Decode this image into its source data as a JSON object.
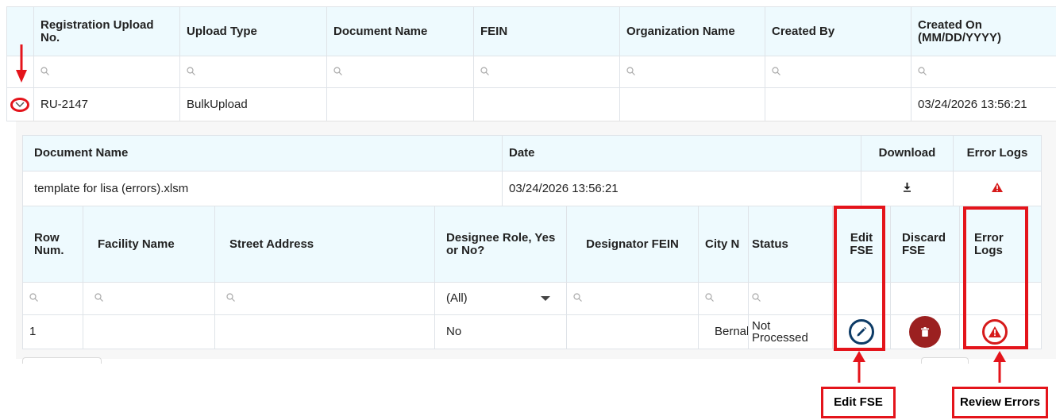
{
  "top_table": {
    "headers": [
      "Registration Upload No.",
      "Upload Type",
      "Document Name",
      "FEIN",
      "Organization Name",
      "Created By",
      "Created On (MM/DD/YYYY)"
    ],
    "row": {
      "reg_no": "RU-2147",
      "upload_type": "BulkUpload",
      "document_name": "",
      "fein": "",
      "org_name": "",
      "created_by": "",
      "created_on": "03/24/2026 13:56:21"
    }
  },
  "doc_table": {
    "headers": [
      "Document Name",
      "Date",
      "Download",
      "Error Logs"
    ],
    "row": {
      "document_name": "template for lisa (errors).xlsm",
      "date": "03/24/2026 13:56:21"
    }
  },
  "detail_table": {
    "headers": [
      "Row Num.",
      "Facility Name",
      "Street Address",
      "Designee Role, Yes or No?",
      "Designator FEIN",
      "City N",
      "Status",
      "Edit FSE",
      "Discard FSE",
      "Error Logs"
    ],
    "filter_select": "(All)",
    "row": {
      "row_num": "1",
      "facility_name": "",
      "street_address": "",
      "designee_role": "No",
      "designator_fein": "",
      "city": "Bernal",
      "status": "Not Processed"
    }
  },
  "callouts": {
    "edit": "Edit FSE",
    "review": "Review Errors"
  },
  "colors": {
    "header_bg": "#eefafe",
    "annotation_red": "#e4141b",
    "discard_red": "#9b2020",
    "edit_blue": "#0d3b66"
  }
}
